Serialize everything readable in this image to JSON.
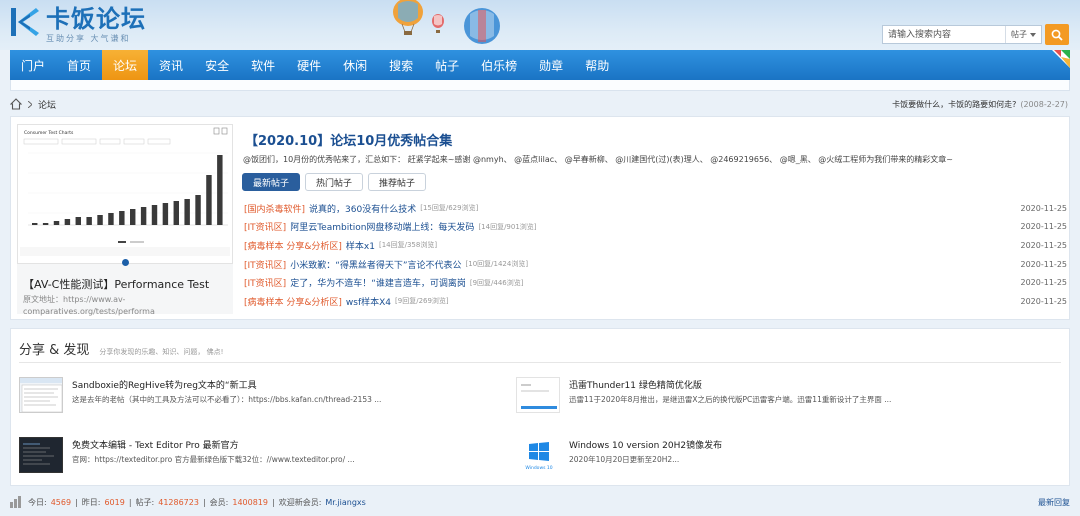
{
  "header": {
    "logo_title": "卡饭论坛",
    "logo_sub": "互助分享  大气谦和",
    "search_placeholder": "请输入搜索内容",
    "search_type": "帖子"
  },
  "nav": [
    "门户",
    "首页",
    "论坛",
    "资讯",
    "安全",
    "软件",
    "硬件",
    "休闲",
    "搜索",
    "帖子",
    "伯乐榜",
    "勋章",
    "帮助"
  ],
  "nav_active": 2,
  "breadcrumb": {
    "current": "论坛"
  },
  "notice": {
    "text": "卡饭要做什么，卡饭的路要如何走?",
    "date": "(2008-2-27)"
  },
  "slide": {
    "chart_title": "Consumer Test Charts",
    "caption": "【AV-C性能测试】Performance Test",
    "sub_line1": "原文地址：https://www.av-",
    "sub_line2": "comparatives.org/tests/performa"
  },
  "hot": {
    "title": "【2020.10】论坛10月优秀帖合集",
    "desc": "@饭团们，10月份的优秀帖来了，汇总如下： 赶紧学起来~感谢 @nmyh、 @蓝点lilac、 @早春新柳、 @川建国代(过)(表)理人、 @2469219656、 @嗯_黑、 @火绒工程师为我们带来的精彩文章~"
  },
  "tabs": [
    "最新帖子",
    "热门帖子",
    "推荐帖子"
  ],
  "tab_active": 0,
  "threads": [
    {
      "cat": "[国内杀毒软件]",
      "title": "说真的，360没有什么技术",
      "meta": "[15回复/629浏览]",
      "date": "2020-11-25"
    },
    {
      "cat": "[IT资讯区]",
      "title": "阿里云Teambition网盘移动端上线：每天发码",
      "meta": "[14回复/901浏览]",
      "date": "2020-11-25"
    },
    {
      "cat": "[病毒样本 分享&分析区]",
      "title": "样本x1",
      "meta": "[14回复/358浏览]",
      "date": "2020-11-25"
    },
    {
      "cat": "[IT资讯区]",
      "title": "小米致歉：“得黑丝者得天下”言论不代表公",
      "meta": "[10回复/1424浏览]",
      "date": "2020-11-25"
    },
    {
      "cat": "[IT资讯区]",
      "title": "定了，华为不造车！“谁建言造车，可调离岗",
      "meta": "[9回复/446浏览]",
      "date": "2020-11-25"
    },
    {
      "cat": "[病毒样本 分享&分析区]",
      "title": "wsf样本X4",
      "meta": "[9回复/269浏览]",
      "date": "2020-11-25"
    }
  ],
  "share": {
    "title": "分享 & 发现",
    "subtitle": "分享你发现的乐趣、知识、问题，  佛点!",
    "items": [
      {
        "name": "Sandboxie的RegHive转为reg文本的“新工具",
        "text": "这是去年的老帖（其中的工具及方法可以不必看了）：https://bbs.kafan.cn/thread-2153 ..."
      },
      {
        "name": "迅雷Thunder11 绿色精简优化版",
        "text": "迅雷11于2020年8月推出，是继迅雷X之后的换代版PC迅雷客户端。迅雷11重新设计了主界面 ..."
      },
      {
        "name": "免费文本编辑 - Text Editor Pro 最新官方",
        "text": "官网：https://texteditor.pro 官方最新绿色版下载32位：//www.texteditor.pro/ ..."
      },
      {
        "name": "Windows 10 version 20H2镜像发布",
        "text": "2020年10月20日更新至20H2..."
      }
    ],
    "win_label": "Windows 10"
  },
  "stats": {
    "today_label": "今日:",
    "today": "4569",
    "yesterday_label": "昨日:",
    "yesterday": "6019",
    "posts_label": "帖子:",
    "posts": "41286723",
    "members_label": "会员:",
    "members": "1400819",
    "welcome_label": "欢迎新会员:",
    "new_member": "Mr.jiangxs"
  },
  "latest_reply": "最新回复",
  "colors": {
    "nav": "#1a74c4",
    "nav_active": "#ee9513",
    "link": "#1b4f91",
    "category": "#e05a2c"
  },
  "chart_data": {
    "type": "bar",
    "title": "Consumer Test Charts",
    "values": [
      1,
      1,
      2,
      3,
      4,
      4,
      5,
      6,
      7,
      8,
      9,
      10,
      11,
      12,
      13,
      15,
      25,
      35
    ]
  }
}
